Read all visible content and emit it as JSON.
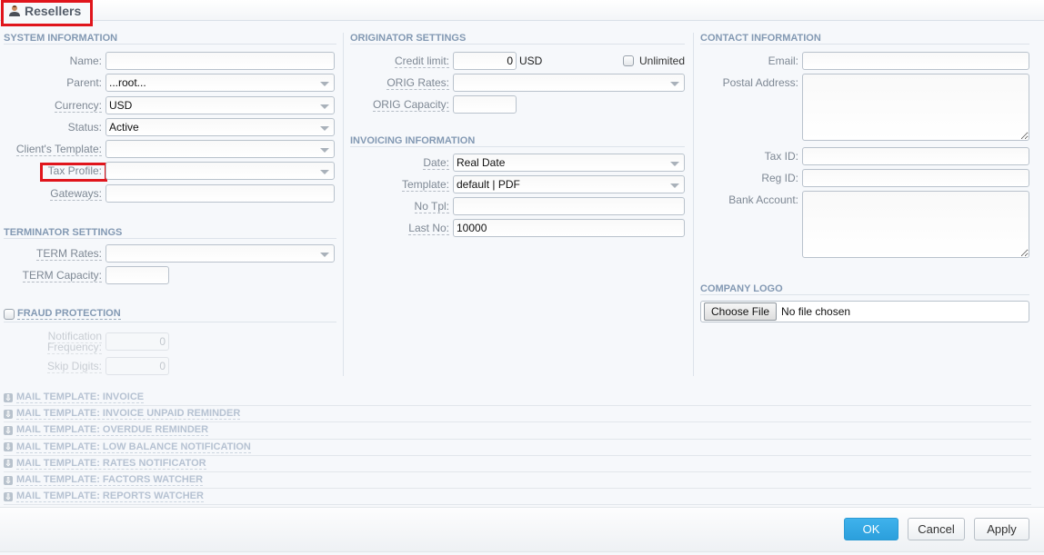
{
  "window": {
    "title": "Resellers",
    "icon": "user-icon"
  },
  "system_information": {
    "title": "SYSTEM INFORMATION",
    "fields": {
      "name": {
        "label": "Name:",
        "value": ""
      },
      "parent": {
        "label": "Parent:",
        "value": "...root..."
      },
      "currency": {
        "label": "Currency:",
        "value": "USD"
      },
      "status": {
        "label": "Status:",
        "value": "Active"
      },
      "clients_template": {
        "label": "Client's Template:",
        "value": ""
      },
      "tax_profile": {
        "label": "Tax Profile:",
        "value": ""
      },
      "gateways": {
        "label": "Gateways:",
        "value": ""
      }
    }
  },
  "terminator_settings": {
    "title": "TERMINATOR SETTINGS",
    "fields": {
      "term_rates": {
        "label": "TERM Rates:",
        "value": ""
      },
      "term_capacity": {
        "label": "TERM Capacity:",
        "value": ""
      }
    }
  },
  "fraud_protection": {
    "title": "FRAUD PROTECTION",
    "enabled": false,
    "fields": {
      "notification_frequency": {
        "label_line1": "Notification",
        "label_line2": "Frequency:",
        "value": "0"
      },
      "skip_digits": {
        "label": "Skip Digits:",
        "value": "0"
      }
    }
  },
  "originator_settings": {
    "title": "ORIGINATOR SETTINGS",
    "fields": {
      "credit_limit": {
        "label": "Credit limit:",
        "value": "0",
        "unit": "USD"
      },
      "unlimited": {
        "label": "Unlimited",
        "checked": false
      },
      "orig_rates": {
        "label": "ORIG Rates:",
        "value": ""
      },
      "orig_capacity": {
        "label": "ORIG Capacity:",
        "value": ""
      }
    }
  },
  "invoicing_information": {
    "title": "INVOICING INFORMATION",
    "fields": {
      "date": {
        "label": "Date:",
        "value": "Real Date"
      },
      "template": {
        "label": "Template:",
        "value": "default | PDF"
      },
      "no_tpl": {
        "label": "No Tpl:",
        "value": ""
      },
      "last_no": {
        "label": "Last No:",
        "value": "10000"
      }
    }
  },
  "contact_information": {
    "title": "CONTACT INFORMATION",
    "fields": {
      "email": {
        "label": "Email:",
        "value": ""
      },
      "postal_address": {
        "label": "Postal Address:",
        "value": ""
      },
      "tax_id": {
        "label": "Tax ID:",
        "value": ""
      },
      "reg_id": {
        "label": "Reg ID:",
        "value": ""
      },
      "bank_account": {
        "label": "Bank Account:",
        "value": ""
      }
    }
  },
  "company_logo": {
    "title": "COMPANY LOGO",
    "choose_file_label": "Choose File",
    "file_status": "No file chosen"
  },
  "mail_templates": [
    {
      "label": "MAIL TEMPLATE: INVOICE"
    },
    {
      "label": "MAIL TEMPLATE: INVOICE UNPAID REMINDER"
    },
    {
      "label": "MAIL TEMPLATE: OVERDUE REMINDER"
    },
    {
      "label": "MAIL TEMPLATE: LOW BALANCE NOTIFICATION"
    },
    {
      "label": "MAIL TEMPLATE: RATES NOTIFICATOR"
    },
    {
      "label": "MAIL TEMPLATE: FACTORS WATCHER"
    },
    {
      "label": "MAIL TEMPLATE: REPORTS WATCHER"
    }
  ],
  "footer": {
    "ok_label": "OK",
    "cancel_label": "Cancel",
    "apply_label": "Apply"
  },
  "colors": {
    "highlight": "#e0151c",
    "primary_button": "#2fa6e2",
    "section_title": "#8399b3"
  }
}
